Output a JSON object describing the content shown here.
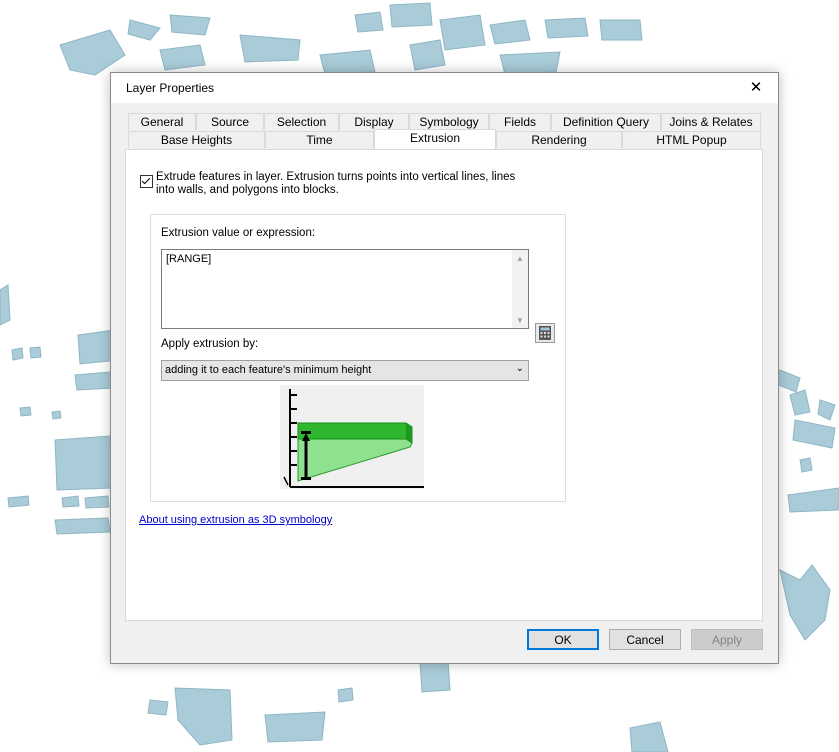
{
  "window": {
    "title": "Layer Properties",
    "close_glyph": "✕"
  },
  "tabs_row1": [
    "General",
    "Source",
    "Selection",
    "Display",
    "Symbology",
    "Fields",
    "Definition Query",
    "Joins & Relates"
  ],
  "tabs_row2": [
    "Base Heights",
    "Time",
    "Extrusion",
    "Rendering",
    "HTML Popup"
  ],
  "active_tab": "Extrusion",
  "extrusion": {
    "checkbox_checked": true,
    "checkbox_label": "Extrude features in layer.  Extrusion turns points into vertical lines, lines into walls, and polygons into blocks.",
    "expression_label": "Extrusion value or expression:",
    "expression_value": "[RANGE]",
    "apply_label": "Apply extrusion by:",
    "apply_selected": "adding it to each feature's minimum height",
    "calculator_icon": "calculator-icon",
    "help_link": "About using extrusion as 3D symbology"
  },
  "buttons": {
    "ok": "OK",
    "cancel": "Cancel",
    "apply": "Apply"
  },
  "colors": {
    "map_buildings": "#a9ccd8",
    "link": "#0000cc",
    "extrusion_green": "#36c436"
  }
}
